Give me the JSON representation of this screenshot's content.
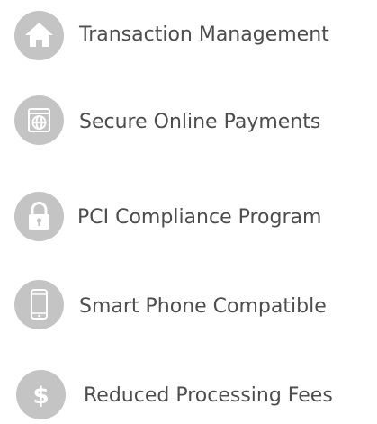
{
  "features": [
    {
      "icon": "home-icon",
      "label": "Transaction Management"
    },
    {
      "icon": "globe-window-icon",
      "label": "Secure Online Payments"
    },
    {
      "icon": "padlock-icon",
      "label": "PCI Compliance Program"
    },
    {
      "icon": "smartphone-icon",
      "label": "Smart Phone Compatible"
    },
    {
      "icon": "dollar-icon",
      "label": "Reduced Processing Fees"
    }
  ],
  "colors": {
    "icon_background": "#c4c4c4",
    "icon_foreground": "#ffffff",
    "text": "#4d4d4d"
  }
}
